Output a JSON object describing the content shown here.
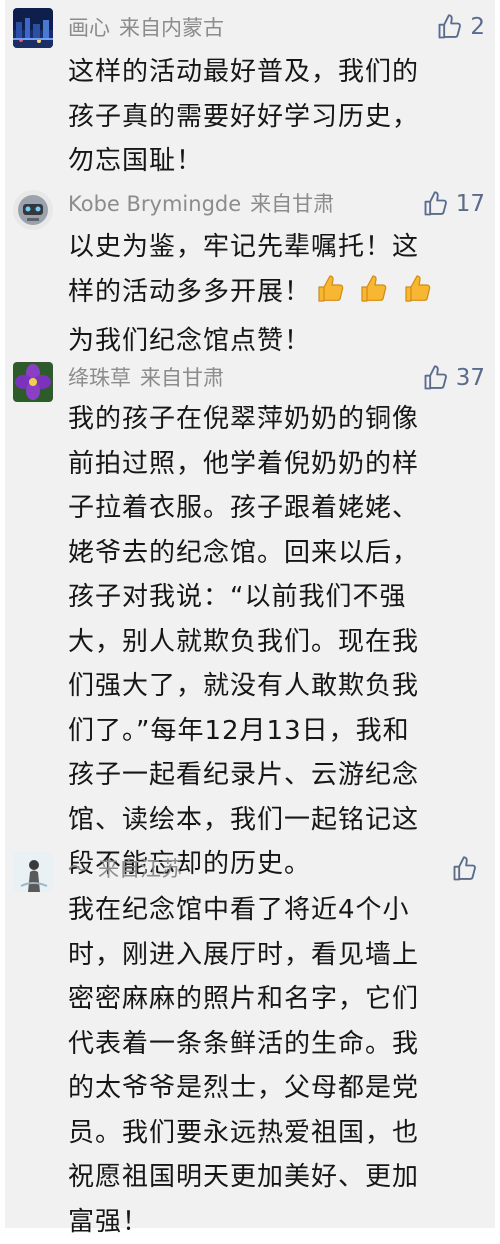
{
  "comments": [
    {
      "nickname": "画心",
      "location": "来自内蒙古",
      "likes": "2",
      "avatar_icon": "night-city-avatar-icon",
      "lines": [
        "这样的活动最好普及，我们的",
        "孩子真的需要好好学习历史，",
        "勿忘国耻！"
      ]
    },
    {
      "nickname": "Kobe Brymingde",
      "location": "来自甘肃",
      "likes": "17",
      "avatar_icon": "robot-avatar-icon",
      "lines": [
        "以史为鉴，牢记先辈嘱托！这",
        "样的活动多多开展！",
        "为我们纪念馆点赞！"
      ],
      "emoji": [
        "thumbs-up-icon",
        "thumbs-up-icon",
        "thumbs-up-icon"
      ]
    },
    {
      "nickname": "绛珠草",
      "location": "来自甘肃",
      "likes": "37",
      "avatar_icon": "purple-flower-avatar-icon",
      "lines": [
        "我的孩子在倪翠萍奶奶的铜像",
        "前拍过照，他学着倪奶奶的样",
        "子拉着衣服。孩子跟着姥姥、",
        "姥爷去的纪念馆。回来以后，",
        "孩子对我说：“以前我们不强",
        "大，别人就欺负我们。现在我",
        "们强大了，就没有人敢欺负我",
        "们了。”每年12月13日，我和",
        "孩子一起看纪录片、云游纪念",
        "馆、读绘本，我们一起铭记这",
        "段不能忘却的历史。"
      ]
    },
    {
      "nickname": "～",
      "location": "来自江苏",
      "likes": "",
      "avatar_icon": "girl-silhouette-avatar-icon",
      "lines": [
        "我在纪念馆中看了将近4个小",
        "时，刚进入展厅时，看见墙上",
        "密密麻麻的照片和名字，它们",
        "代表着一条条鲜活的生命。我",
        "的太爷爷是烈士，父母都是党",
        "员。我们要永远热爱祖国，也",
        "祝愿祖国明天更加美好、更加",
        "富强！"
      ]
    }
  ]
}
